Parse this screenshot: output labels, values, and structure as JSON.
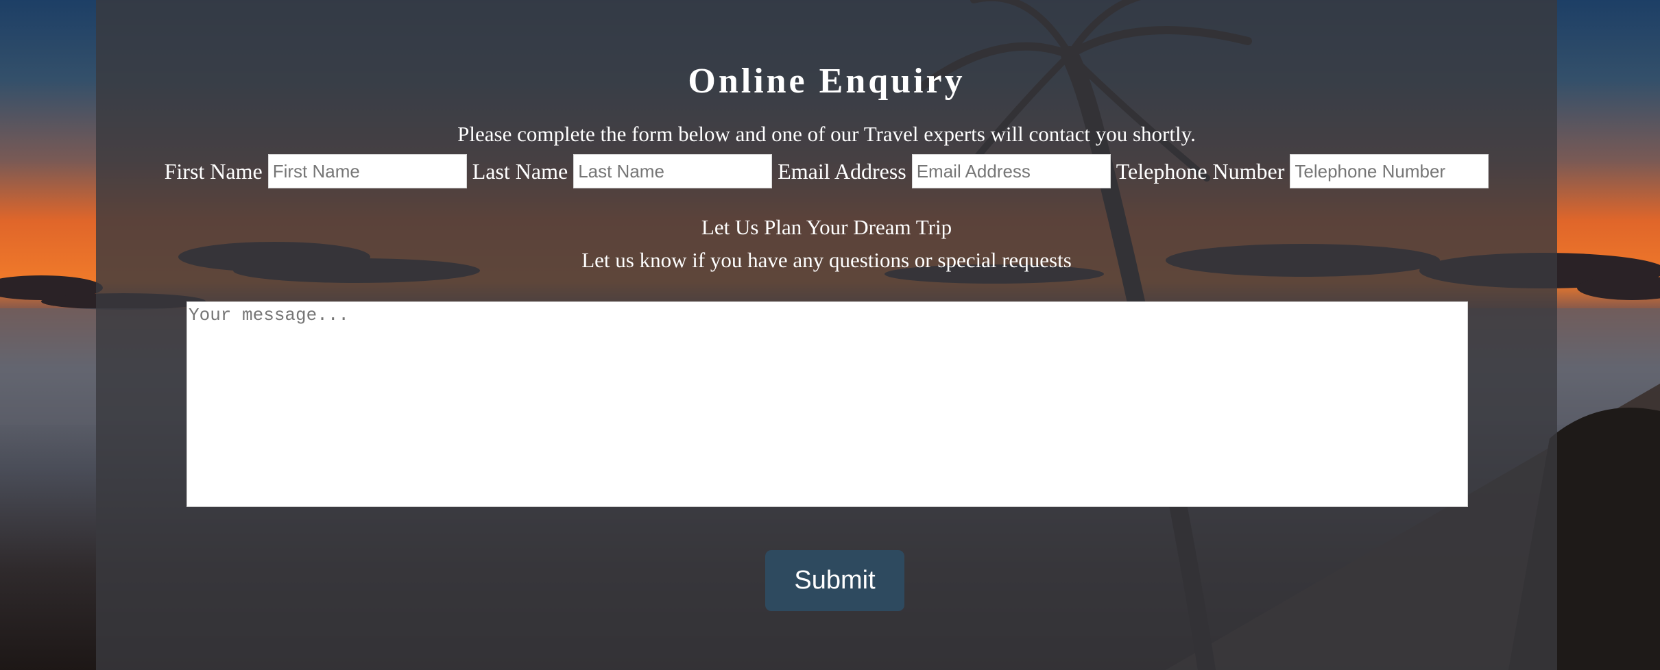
{
  "form": {
    "title": "Online Enquiry",
    "intro": "Please complete the form below and one of our Travel experts will contact you shortly.",
    "fields": [
      {
        "label": "First Name",
        "placeholder": "First Name"
      },
      {
        "label": "Last Name",
        "placeholder": "Last Name"
      },
      {
        "label": "Email Address",
        "placeholder": "Email Address"
      },
      {
        "label": "Telephone Number",
        "placeholder": "Telephone Number"
      }
    ],
    "subheading": "Let Us Plan Your Dream Trip",
    "subtext": "Let us know if you have any questions or special requests",
    "message_placeholder": "Your message...",
    "submit_label": "Submit"
  },
  "colors": {
    "panel_overlay": "#3a3a3e",
    "submit_button": "#2e4a5f",
    "text": "#ffffff"
  }
}
